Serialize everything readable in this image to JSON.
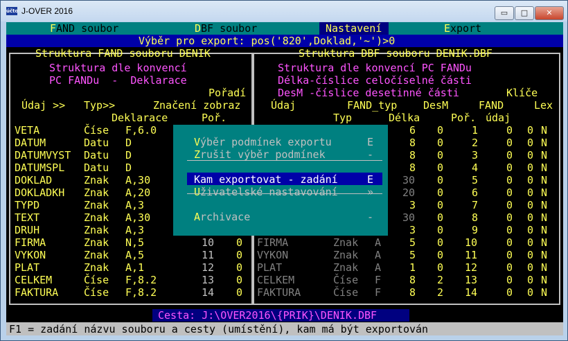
{
  "window": {
    "title": "J-OVER 2016",
    "icon_text": "účto",
    "minimize": "▭",
    "maximize": "□",
    "close": "✕"
  },
  "menu": {
    "items": [
      {
        "hot": "F",
        "rest": "AND soubor"
      },
      {
        "hot": "D",
        "rest": "BF soubor"
      },
      {
        "hot": "",
        "rest": "Nastavení"
      },
      {
        "hot": "E",
        "rest": "xport"
      }
    ]
  },
  "status_line": "Výběr pro export: pos('820',Doklad,'~')>0",
  "left": {
    "title": "Struktura FAND souboru DENIK",
    "conv1": "Struktura dle konvencí",
    "conv2": "PC FANDu  -  Deklarace",
    "poradi": "Pořadí",
    "hdr_udaj": "Údaj >>",
    "hdr_typ": "Typ>>",
    "hdr_znaceni": "Značení zobraz",
    "rule_deklarace": "Deklarace",
    "rule_por": "Poř.",
    "rows": [
      {
        "name": "VETA",
        "type": "Číse",
        "decl": "F,6.0",
        "por": "",
        "flag": ""
      },
      {
        "name": "DATUM",
        "type": "Datu",
        "decl": "D",
        "por": "",
        "flag": ""
      },
      {
        "name": "DATUMVYST",
        "type": "Datu",
        "decl": "D",
        "por": "",
        "flag": ""
      },
      {
        "name": "DATUMSPL",
        "type": "Datu",
        "decl": "D",
        "por": "",
        "flag": ""
      },
      {
        "name": "DOKLAD",
        "type": "Znak",
        "decl": "A,30",
        "por": "",
        "flag": ""
      },
      {
        "name": "DOKLADKH",
        "type": "Znak",
        "decl": "A,20",
        "por": "",
        "flag": ""
      },
      {
        "name": "TYPD",
        "type": "Znak",
        "decl": "A,3",
        "por": "",
        "flag": ""
      },
      {
        "name": "TEXT",
        "type": "Znak",
        "decl": "A,30",
        "por": "",
        "flag": ""
      },
      {
        "name": "DRUH",
        "type": "Znak",
        "decl": "A,3",
        "por": "",
        "flag": ""
      },
      {
        "name": "FIRMA",
        "type": "Znak",
        "decl": "N,5",
        "por": "10",
        "flag": "0"
      },
      {
        "name": "VYKON",
        "type": "Znak",
        "decl": "A,5",
        "por": "11",
        "flag": "0"
      },
      {
        "name": "PLAT",
        "type": "Znak",
        "decl": "A,1",
        "por": "12",
        "flag": "0"
      },
      {
        "name": "CELKEM",
        "type": "Číse",
        "decl": "F,8.2",
        "por": "13",
        "flag": "0"
      },
      {
        "name": "FAKTURA",
        "type": "Číse",
        "decl": "F,8.2",
        "por": "14",
        "flag": "0"
      }
    ]
  },
  "right": {
    "title": "Struktura DBF souboru DENIK.DBF",
    "conv1": "Struktura dle konvencí PC FANDu",
    "conv2": "Délka-číslice celočíselné části",
    "conv3": "DesM -číslice desetinné části",
    "klice": "Klíče",
    "hdr_udaj": "Údaj",
    "hdr_fandtyp": "FAND_typ",
    "hdr_desm": "DesM",
    "hdr_fand": "FAND",
    "hdr_lex": "Lex",
    "rule_typ": "Typ",
    "rule_delka": "Délka",
    "rule_por": "Poř.",
    "rule_udaj": "údaj",
    "rows": [
      {
        "name": "",
        "ft": "",
        "t": "",
        "len": "6",
        "des": "0",
        "fand": "1",
        "a": "0",
        "b": "0",
        "lex": "N"
      },
      {
        "name": "",
        "ft": "",
        "t": "",
        "len": "8",
        "des": "0",
        "fand": "2",
        "a": "0",
        "b": "0",
        "lex": "N"
      },
      {
        "name": "",
        "ft": "",
        "t": "",
        "len": "8",
        "des": "0",
        "fand": "3",
        "a": "0",
        "b": "0",
        "lex": "N"
      },
      {
        "name": "",
        "ft": "",
        "t": "",
        "len": "8",
        "des": "0",
        "fand": "4",
        "a": "0",
        "b": "0",
        "lex": "N"
      },
      {
        "name": "",
        "ft": "",
        "t": "",
        "len": "30",
        "des": "0",
        "fand": "5",
        "a": "0",
        "b": "0",
        "lex": "N"
      },
      {
        "name": "",
        "ft": "",
        "t": "",
        "len": "20",
        "des": "0",
        "fand": "6",
        "a": "0",
        "b": "0",
        "lex": "N"
      },
      {
        "name": "",
        "ft": "",
        "t": "",
        "len": "3",
        "des": "0",
        "fand": "7",
        "a": "0",
        "b": "0",
        "lex": "N"
      },
      {
        "name": "",
        "ft": "",
        "t": "",
        "len": "30",
        "des": "0",
        "fand": "8",
        "a": "0",
        "b": "0",
        "lex": "N"
      },
      {
        "name": "",
        "ft": "",
        "t": "",
        "len": "3",
        "des": "0",
        "fand": "9",
        "a": "0",
        "b": "0",
        "lex": "N"
      },
      {
        "name": "FIRMA",
        "ft": "Znak",
        "t": "A",
        "len": "5",
        "des": "0",
        "fand": "10",
        "a": "0",
        "b": "0",
        "lex": "N"
      },
      {
        "name": "VYKON",
        "ft": "Znak",
        "t": "A",
        "len": "5",
        "des": "0",
        "fand": "11",
        "a": "0",
        "b": "0",
        "lex": "N"
      },
      {
        "name": "PLAT",
        "ft": "Znak",
        "t": "A",
        "len": "1",
        "des": "0",
        "fand": "12",
        "a": "0",
        "b": "0",
        "lex": "N"
      },
      {
        "name": "CELKEM",
        "ft": "Číse",
        "t": "F",
        "len": "8",
        "des": "2",
        "fand": "13",
        "a": "0",
        "b": "0",
        "lex": "N"
      },
      {
        "name": "FAKTURA",
        "ft": "Číse",
        "t": "F",
        "len": "8",
        "des": "2",
        "fand": "14",
        "a": "0",
        "b": "0",
        "lex": "N"
      }
    ]
  },
  "popup": {
    "items": [
      {
        "hot": "V",
        "rest": "ýběr podmínek exportu",
        "key": "E"
      },
      {
        "hot": "Z",
        "rest": "rušit výběr podmínek",
        "key": "-"
      },
      {
        "hot": "",
        "rest": "Kam exportovat - zadání",
        "key": "E"
      },
      {
        "hot": "U",
        "rest": "živatelské nastavování",
        "key": "»"
      },
      {
        "hot": "A",
        "rest": "rchivace",
        "key": "-"
      }
    ]
  },
  "path": "Cesta: J:\\OVER2016\\{PRIK}\\DENIK.DBF",
  "help": "F1 = zadání názvu souboru a cesty (umístění), kam má být exportován",
  "colors": {
    "yellow": "#ffff55",
    "magenta": "#ff55ff",
    "teal": "#008080",
    "blue": "#0000a8",
    "grey": "#c0c0c0",
    "white": "#ffffff",
    "dim": "#808080"
  }
}
